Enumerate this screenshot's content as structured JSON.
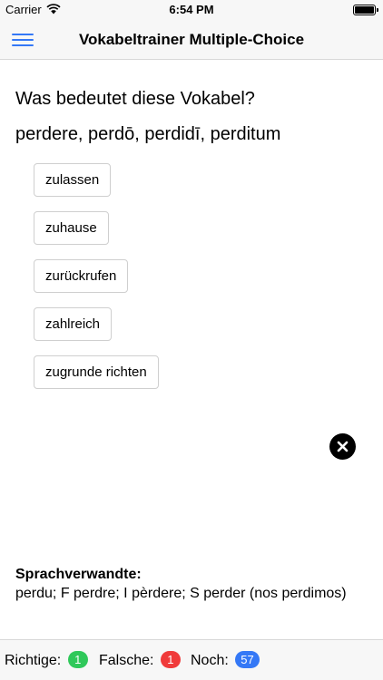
{
  "status_bar": {
    "carrier": "Carrier",
    "time": "6:54 PM",
    "battery_level": 1.0
  },
  "nav": {
    "menu_icon": "hamburger-icon",
    "title": "Vokabeltrainer Multiple-Choice"
  },
  "quiz": {
    "question": "Was bedeutet diese Vokabel?",
    "vocabulary": "perdere, perdō, perdidī, perditum",
    "answers": [
      "zulassen",
      "zuhause",
      "zurückrufen",
      "zahlreich",
      "zugrunde richten"
    ]
  },
  "close_icon": "close-icon",
  "cognates": {
    "heading": "Sprachverwandte:",
    "text": "perdu; F perdre; I pèrdere; S perder (nos perdimos)"
  },
  "footer": {
    "correct_label": "Richtige:",
    "correct_count": "1",
    "wrong_label": "Falsche:",
    "wrong_count": "1",
    "remaining_label": "Noch:",
    "remaining_count": "57"
  },
  "colors": {
    "accent": "#3478f6",
    "correct": "#2fc85a",
    "wrong": "#f03a3a",
    "remaining": "#3478f6"
  }
}
